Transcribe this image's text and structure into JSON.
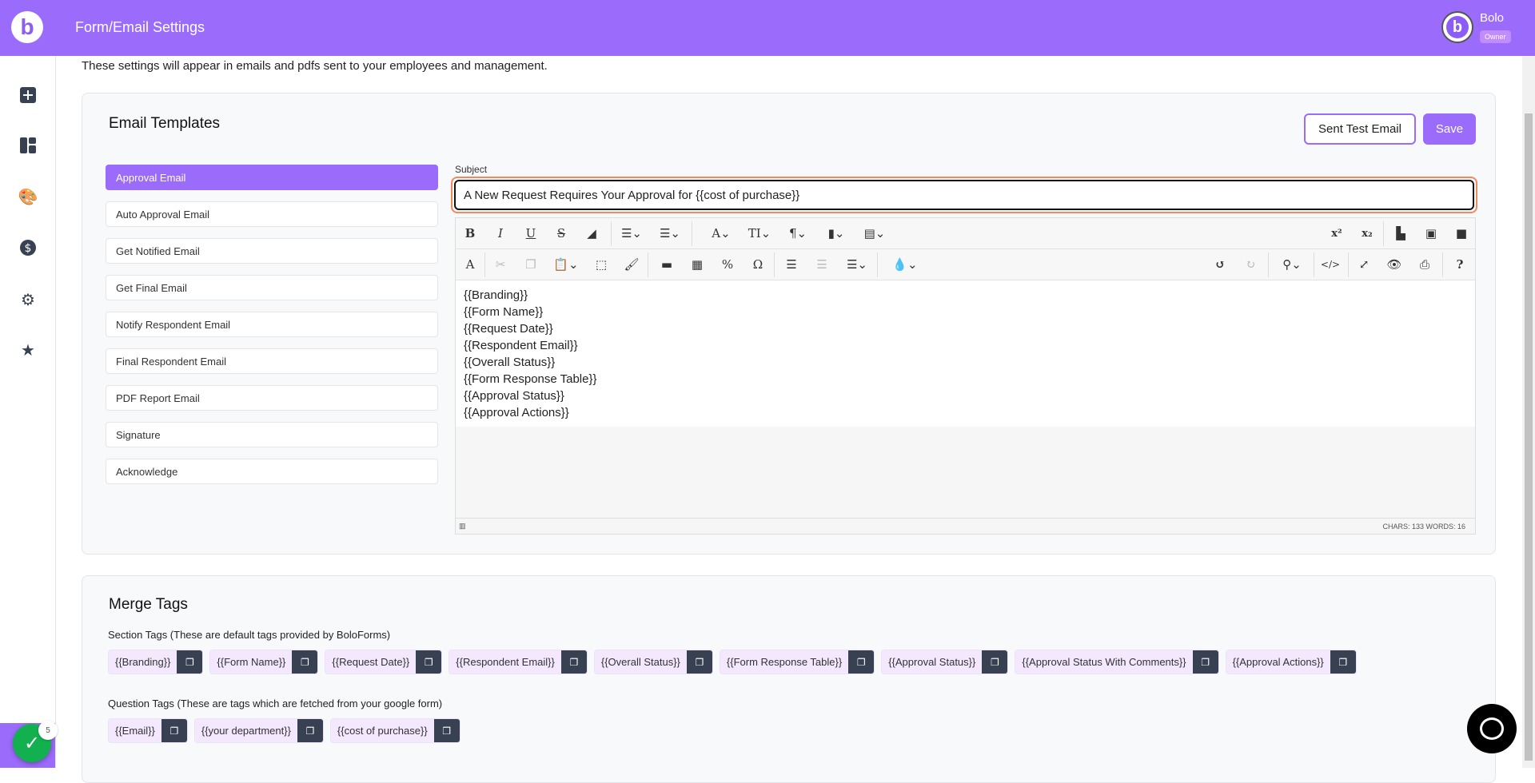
{
  "header": {
    "title": "Form/Email Settings",
    "user_name": "Bolo",
    "user_role": "Owner",
    "logo_letter": "b"
  },
  "sidebar": {
    "icons": [
      "plus-square-icon",
      "dashboard-icon",
      "palette-icon",
      "dollar-icon",
      "gear-icon",
      "star-icon"
    ],
    "badge_count": "5"
  },
  "subtitle": "These settings will appear in emails and pdfs sent to your employees and management.",
  "email_templates": {
    "title": "Email Templates",
    "test_button": "Sent Test Email",
    "save_button": "Save",
    "items": [
      "Approval Email",
      "Auto Approval Email",
      "Get Notified Email",
      "Get Final Email",
      "Notify Respondent Email",
      "Final Respondent Email",
      "PDF Report Email",
      "Signature",
      "Acknowledge"
    ],
    "subject_label": "Subject",
    "subject_value": "A New Request Requires Your Approval for {{cost of purchase}}",
    "body_lines": [
      "{{Branding}}",
      "{{Form Name}}",
      "{{Request Date}}",
      "{{Respondent Email}}",
      "{{Overall Status}}",
      "{{Form Response Table}}",
      "{{Approval Status}}",
      "{{Approval Actions}}"
    ],
    "status": "CHARS: 133  WORDS: 16"
  },
  "merge_tags": {
    "title": "Merge Tags",
    "section_label": "Section Tags (These are default tags provided by BoloForms)",
    "section_tags": [
      "{{Branding}}",
      "{{Form Name}}",
      "{{Request Date}}",
      "{{Respondent Email}}",
      "{{Overall Status}}",
      "{{Form Response Table}}",
      "{{Approval Status}}",
      "{{Approval Status With Comments}}",
      "{{Approval Actions}}"
    ],
    "question_label": "Question Tags (These are tags which are fetched from your google form)",
    "question_tags": [
      "{{Email}}",
      "{{your department}}",
      "{{cost of purchase}}"
    ]
  },
  "colors": {
    "accent": "#9b6bfb",
    "focus": "#f08a5d",
    "copy_button": "#374151",
    "success": "#12b04f"
  }
}
